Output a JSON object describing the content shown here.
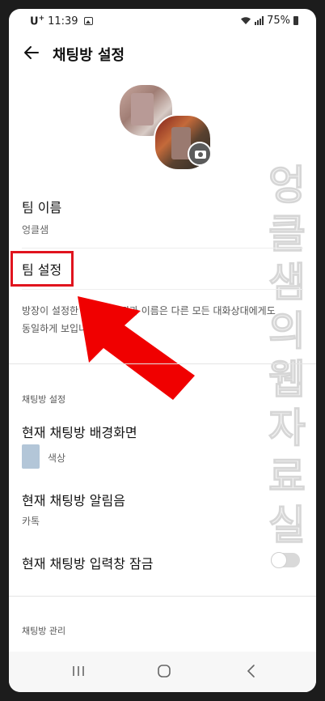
{
  "status_bar": {
    "carrier": "U",
    "carrier_sup": "+",
    "time": "11:39",
    "battery": "75%"
  },
  "header": {
    "title": "채팅방 설정"
  },
  "team_name": {
    "label": "팀 이름",
    "value": "엉클샘"
  },
  "team_settings": {
    "label": "팀 설정",
    "description_line1": "방장이 설정한 프로필 사진과 이름은 다른 모든 대화상대에게도",
    "description_line2": "동일하게 보입니다."
  },
  "chat_settings": {
    "section_title": "채팅방 설정",
    "background": {
      "label": "현재 채팅방 배경화면",
      "value": "색상",
      "color": "#b3c6d8"
    },
    "notification_sound": {
      "label": "현재 채팅방 알림음",
      "value": "카톡"
    },
    "input_lock": {
      "label": "현재 채팅방 입력창 잠금",
      "enabled": false
    }
  },
  "chat_management": {
    "section_title": "채팅방 관리"
  },
  "watermark": "엉클샘의웹자료실",
  "colors": {
    "highlight_red": "#e0141e",
    "arrow_red": "#f00000"
  },
  "icons": [
    "back-arrow-icon",
    "camera-icon",
    "wifi-icon",
    "signal-icon",
    "battery-icon",
    "recent-apps-icon",
    "home-icon",
    "nav-back-icon"
  ]
}
